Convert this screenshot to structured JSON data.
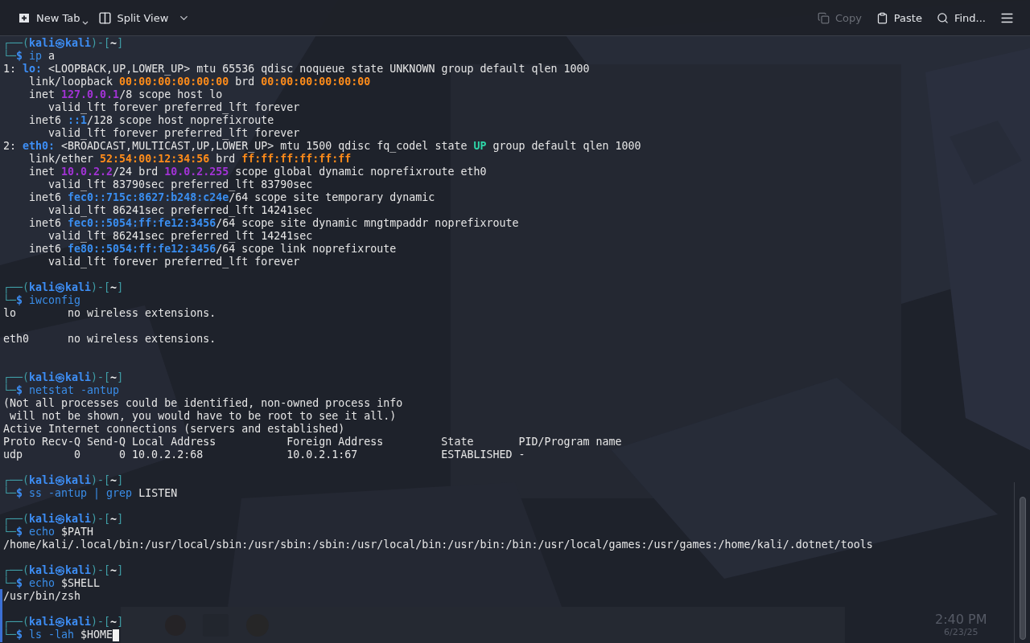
{
  "toolbar": {
    "left": [
      {
        "label": "New Tab",
        "kind": "split"
      },
      {
        "label": "Split View",
        "kind": "menu"
      }
    ],
    "right": [
      {
        "label": "Copy",
        "disabled": true
      },
      {
        "label": "Paste",
        "disabled": false
      },
      {
        "label": "Find...",
        "disabled": false
      }
    ]
  },
  "terminal": {
    "lines": [
      {
        "kind": "line",
        "segments": [
          {
            "text": "┌──(",
            "kind": "frame"
          },
          {
            "text": "kali㉿kali",
            "kind": "user"
          },
          {
            "text": ")-[",
            "kind": "frame"
          },
          {
            "text": "~",
            "kind": "dir"
          },
          {
            "text": "]",
            "kind": "frame"
          }
        ]
      },
      {
        "kind": "line",
        "segments": [
          {
            "text": "└─",
            "kind": "frame"
          },
          {
            "text": "$ ",
            "kind": "dollar"
          },
          {
            "text": "ip",
            "kind": "cmd"
          },
          {
            "text": " a",
            "kind": "text"
          }
        ]
      },
      {
        "kind": "line",
        "segments": [
          {
            "text": "1: ",
            "kind": "text"
          },
          {
            "text": "lo:",
            "kind": "iface"
          },
          {
            "text": " <LOOPBACK,UP,LOWER_UP> mtu 65536 qdisc noqueue state UNKNOWN group default qlen 1000",
            "kind": "text"
          }
        ]
      },
      {
        "kind": "line",
        "segments": [
          {
            "text": "    link/loopback ",
            "kind": "text"
          },
          {
            "text": "00:00:00:00:00:00",
            "kind": "mac"
          },
          {
            "text": " brd ",
            "kind": "text"
          },
          {
            "text": "00:00:00:00:00:00",
            "kind": "mac"
          }
        ]
      },
      {
        "kind": "line",
        "segments": [
          {
            "text": "    inet ",
            "kind": "text"
          },
          {
            "text": "127.0.0.1",
            "kind": "ipv4"
          },
          {
            "text": "/8 scope host lo",
            "kind": "text"
          }
        ]
      },
      {
        "kind": "line",
        "segments": [
          {
            "text": "       valid_lft forever preferred_lft forever",
            "kind": "text"
          }
        ]
      },
      {
        "kind": "line",
        "segments": [
          {
            "text": "    inet6 ",
            "kind": "text"
          },
          {
            "text": "::1",
            "kind": "ipv6"
          },
          {
            "text": "/128 scope host noprefixroute",
            "kind": "text"
          }
        ]
      },
      {
        "kind": "line",
        "segments": [
          {
            "text": "       valid_lft forever preferred_lft forever",
            "kind": "text"
          }
        ]
      },
      {
        "kind": "line",
        "segments": [
          {
            "text": "2: ",
            "kind": "text"
          },
          {
            "text": "eth0:",
            "kind": "iface"
          },
          {
            "text": " <BROADCAST,MULTICAST,UP,LOWER_UP> mtu 1500 qdisc fq_codel state ",
            "kind": "text"
          },
          {
            "text": "UP",
            "kind": "state"
          },
          {
            "text": " group default qlen 1000",
            "kind": "text"
          }
        ]
      },
      {
        "kind": "line",
        "segments": [
          {
            "text": "    link/ether ",
            "kind": "text"
          },
          {
            "text": "52:54:00:12:34:56",
            "kind": "mac"
          },
          {
            "text": " brd ",
            "kind": "text"
          },
          {
            "text": "ff:ff:ff:ff:ff:ff",
            "kind": "mac"
          }
        ]
      },
      {
        "kind": "line",
        "segments": [
          {
            "text": "    inet ",
            "kind": "text"
          },
          {
            "text": "10.0.2.2",
            "kind": "ipv4"
          },
          {
            "text": "/24 brd ",
            "kind": "text"
          },
          {
            "text": "10.0.2.255",
            "kind": "ipv4"
          },
          {
            "text": " scope global dynamic noprefixroute eth0",
            "kind": "text"
          }
        ]
      },
      {
        "kind": "line",
        "segments": [
          {
            "text": "       valid_lft 83790sec preferred_lft 83790sec",
            "kind": "text"
          }
        ]
      },
      {
        "kind": "line",
        "segments": [
          {
            "text": "    inet6 ",
            "kind": "text"
          },
          {
            "text": "fec0::715c:8627:b248:c24e",
            "kind": "ipv6"
          },
          {
            "text": "/64 scope site temporary dynamic",
            "kind": "text"
          }
        ]
      },
      {
        "kind": "line",
        "segments": [
          {
            "text": "       valid_lft 86241sec preferred_lft 14241sec",
            "kind": "text"
          }
        ]
      },
      {
        "kind": "line",
        "segments": [
          {
            "text": "    inet6 ",
            "kind": "text"
          },
          {
            "text": "fec0::5054:ff:fe12:3456",
            "kind": "ipv6"
          },
          {
            "text": "/64 scope site dynamic mngtmpaddr noprefixroute",
            "kind": "text"
          }
        ]
      },
      {
        "kind": "line",
        "segments": [
          {
            "text": "       valid_lft 86241sec preferred_lft 14241sec",
            "kind": "text"
          }
        ]
      },
      {
        "kind": "line",
        "segments": [
          {
            "text": "    inet6 ",
            "kind": "text"
          },
          {
            "text": "fe80::5054:ff:fe12:3456",
            "kind": "ipv6"
          },
          {
            "text": "/64 scope link noprefixroute",
            "kind": "text"
          }
        ]
      },
      {
        "kind": "line",
        "segments": [
          {
            "text": "       valid_lft forever preferred_lft forever",
            "kind": "text"
          }
        ]
      },
      {
        "kind": "blank"
      },
      {
        "kind": "line",
        "segments": [
          {
            "text": "┌──(",
            "kind": "frame"
          },
          {
            "text": "kali㉿kali",
            "kind": "user"
          },
          {
            "text": ")-[",
            "kind": "frame"
          },
          {
            "text": "~",
            "kind": "dir"
          },
          {
            "text": "]",
            "kind": "frame"
          }
        ]
      },
      {
        "kind": "line",
        "segments": [
          {
            "text": "└─",
            "kind": "frame"
          },
          {
            "text": "$ ",
            "kind": "dollar"
          },
          {
            "text": "iwconfig",
            "kind": "cmd"
          }
        ]
      },
      {
        "kind": "line",
        "segments": [
          {
            "text": "lo        no wireless extensions.",
            "kind": "text"
          }
        ]
      },
      {
        "kind": "blank"
      },
      {
        "kind": "line",
        "segments": [
          {
            "text": "eth0      no wireless extensions.",
            "kind": "text"
          }
        ]
      },
      {
        "kind": "blank"
      },
      {
        "kind": "blank"
      },
      {
        "kind": "line",
        "segments": [
          {
            "text": "┌──(",
            "kind": "frame"
          },
          {
            "text": "kali㉿kali",
            "kind": "user"
          },
          {
            "text": ")-[",
            "kind": "frame"
          },
          {
            "text": "~",
            "kind": "dir"
          },
          {
            "text": "]",
            "kind": "frame"
          }
        ]
      },
      {
        "kind": "line",
        "segments": [
          {
            "text": "└─",
            "kind": "frame"
          },
          {
            "text": "$ ",
            "kind": "dollar"
          },
          {
            "text": "netstat -antup",
            "kind": "cmd"
          }
        ]
      },
      {
        "kind": "line",
        "segments": [
          {
            "text": "(Not all processes could be identified, non-owned process info",
            "kind": "text"
          }
        ]
      },
      {
        "kind": "line",
        "segments": [
          {
            "text": " will not be shown, you would have to be root to see it all.)",
            "kind": "text"
          }
        ]
      },
      {
        "kind": "line",
        "segments": [
          {
            "text": "Active Internet connections (servers and established)",
            "kind": "text"
          }
        ]
      },
      {
        "kind": "line",
        "segments": [
          {
            "text": "Proto Recv-Q Send-Q Local Address           Foreign Address         State       PID/Program name",
            "kind": "text"
          }
        ]
      },
      {
        "kind": "line",
        "segments": [
          {
            "text": "udp        0      0 10.0.2.2:68             10.0.2.1:67             ESTABLISHED -",
            "kind": "text"
          }
        ]
      },
      {
        "kind": "blank"
      },
      {
        "kind": "line",
        "segments": [
          {
            "text": "┌──(",
            "kind": "frame"
          },
          {
            "text": "kali㉿kali",
            "kind": "user"
          },
          {
            "text": ")-[",
            "kind": "frame"
          },
          {
            "text": "~",
            "kind": "dir"
          },
          {
            "text": "]",
            "kind": "frame"
          }
        ]
      },
      {
        "kind": "line",
        "segments": [
          {
            "text": "└─",
            "kind": "frame"
          },
          {
            "text": "$ ",
            "kind": "dollar"
          },
          {
            "text": "ss -antup | grep",
            "kind": "cmd"
          },
          {
            "text": " LISTEN",
            "kind": "text"
          }
        ]
      },
      {
        "kind": "blank"
      },
      {
        "kind": "line",
        "segments": [
          {
            "text": "┌──(",
            "kind": "frame"
          },
          {
            "text": "kali㉿kali",
            "kind": "user"
          },
          {
            "text": ")-[",
            "kind": "frame"
          },
          {
            "text": "~",
            "kind": "dir"
          },
          {
            "text": "]",
            "kind": "frame"
          }
        ]
      },
      {
        "kind": "line",
        "segments": [
          {
            "text": "└─",
            "kind": "frame"
          },
          {
            "text": "$ ",
            "kind": "dollar"
          },
          {
            "text": "echo",
            "kind": "cmd"
          },
          {
            "text": " $PATH",
            "kind": "text"
          }
        ]
      },
      {
        "kind": "line",
        "segments": [
          {
            "text": "/home/kali/.local/bin:/usr/local/sbin:/usr/sbin:/sbin:/usr/local/bin:/usr/bin:/bin:/usr/local/games:/usr/games:/home/kali/.dotnet/tools",
            "kind": "text"
          }
        ]
      },
      {
        "kind": "blank"
      },
      {
        "kind": "line",
        "segments": [
          {
            "text": "┌──(",
            "kind": "frame"
          },
          {
            "text": "kali㉿kali",
            "kind": "user"
          },
          {
            "text": ")-[",
            "kind": "frame"
          },
          {
            "text": "~",
            "kind": "dir"
          },
          {
            "text": "]",
            "kind": "frame"
          }
        ]
      },
      {
        "kind": "line",
        "segments": [
          {
            "text": "└─",
            "kind": "frame"
          },
          {
            "text": "$ ",
            "kind": "dollar"
          },
          {
            "text": "echo",
            "kind": "cmd"
          },
          {
            "text": " $SHELL",
            "kind": "text"
          }
        ]
      },
      {
        "kind": "line",
        "segments": [
          {
            "text": "/usr/bin/zsh",
            "kind": "text"
          }
        ]
      },
      {
        "kind": "blank"
      },
      {
        "kind": "line",
        "segments": [
          {
            "text": "┌──(",
            "kind": "frame"
          },
          {
            "text": "kali㉿kali",
            "kind": "user"
          },
          {
            "text": ")-[",
            "kind": "frame"
          },
          {
            "text": "~",
            "kind": "dir"
          },
          {
            "text": "]",
            "kind": "frame"
          }
        ]
      },
      {
        "kind": "line",
        "cursor": true,
        "segments": [
          {
            "text": "└─",
            "kind": "frame"
          },
          {
            "text": "$ ",
            "kind": "dollar"
          },
          {
            "text": "ls -lah",
            "kind": "cmd"
          },
          {
            "text": " $HOME",
            "kind": "text"
          }
        ]
      }
    ]
  },
  "desktop_behind": {
    "clock_time": "2:40 PM",
    "clock_date": "6/23/25"
  }
}
